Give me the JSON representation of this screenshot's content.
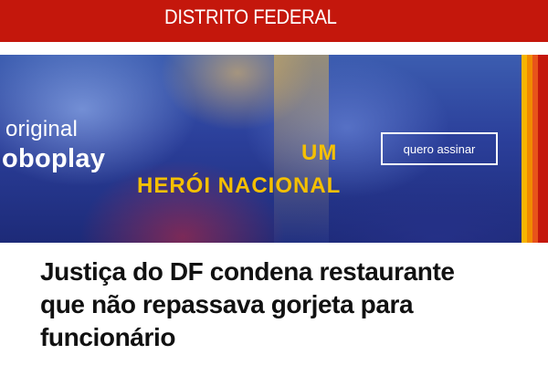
{
  "section": {
    "title": "DISTRITO FEDERAL"
  },
  "banner": {
    "brand_line1": "original",
    "brand_line2": "oboplay",
    "headline_line1": "UM",
    "headline_line2": "HERÓI NACIONAL",
    "cta_label": "quero assinar",
    "colors": {
      "headline": "#f5c000",
      "stripes": [
        "#f7b500",
        "#f08a00",
        "#e8531a",
        "#c4170c"
      ]
    }
  },
  "article": {
    "title": "Justiça do DF condena restaurante que não repassava gorjeta para funcionário"
  },
  "colors": {
    "brand_red": "#c4170c"
  }
}
